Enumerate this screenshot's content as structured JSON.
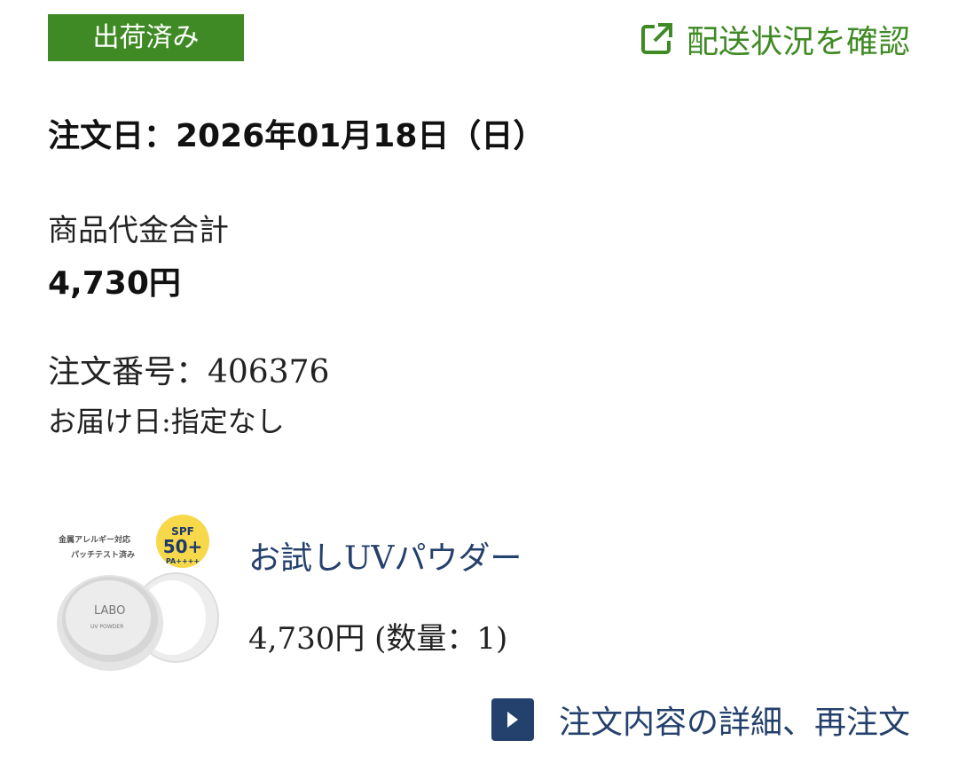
{
  "status": {
    "label": "出荷済み",
    "color": "#3f8a24"
  },
  "tracking": {
    "label": "配送状況を確認",
    "icon": "external-link-icon"
  },
  "order": {
    "date_line": "注文日：2026年01月18日（日）",
    "subtotal_label": "商品代金合計",
    "subtotal_value": "4,730円",
    "number_line": "注文番号：406376",
    "delivery_line": "お届け日:指定なし"
  },
  "product": {
    "name": "お試しUVパウダー",
    "price_line": "4,730円 (数量：1)",
    "image": {
      "badge_top": "SPF",
      "badge_main": "50+",
      "badge_bottom": "PA++++",
      "caption_line1": "金属アレルギー対応",
      "caption_line2": "パッチテスト済み",
      "brand": "LABO",
      "product_text": "UV POWDER"
    }
  },
  "detail_link": {
    "label": "注文内容の詳細、再注文",
    "icon": "play-icon",
    "color": "#24406c"
  }
}
